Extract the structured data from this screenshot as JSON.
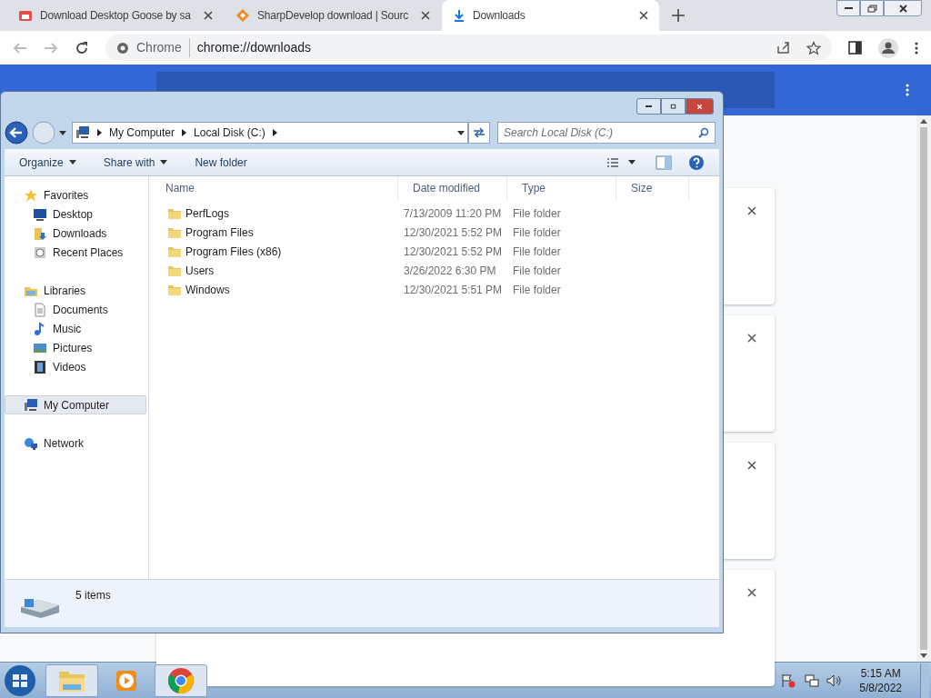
{
  "browser": {
    "tabs": [
      {
        "title": "Download Desktop Goose by sa",
        "kind": "goose",
        "selected": false
      },
      {
        "title": "SharpDevelop download | Sourc",
        "kind": "sharp",
        "selected": false
      },
      {
        "title": "Downloads",
        "kind": "download",
        "selected": true
      }
    ],
    "omnibox": {
      "site_label": "Chrome",
      "url": "chrome://downloads"
    },
    "download_cards": [
      {
        "kind": "item"
      },
      {
        "kind": "item"
      },
      {
        "kind": "item"
      },
      {
        "kind": "item"
      }
    ]
  },
  "explorer": {
    "breadcrumb": [
      "My Computer",
      "Local Disk (C:)"
    ],
    "search_placeholder": "Search Local Disk (C:)",
    "toolbar": [
      {
        "label": "Organize",
        "menu": true
      },
      {
        "label": "Share with",
        "menu": true
      },
      {
        "label": "New folder",
        "menu": false
      }
    ],
    "nav": [
      {
        "label": "Favorites",
        "kind": "star",
        "selected": false,
        "children": [
          {
            "label": "Desktop",
            "kind": "desktop",
            "selected": false
          },
          {
            "label": "Downloads",
            "kind": "downloads",
            "selected": false
          },
          {
            "label": "Recent Places",
            "kind": "recent",
            "selected": false
          }
        ]
      },
      {
        "label": "Libraries",
        "kind": "library",
        "selected": false,
        "children": [
          {
            "label": "Documents",
            "kind": "document",
            "selected": false
          },
          {
            "label": "Music",
            "kind": "music",
            "selected": false
          },
          {
            "label": "Pictures",
            "kind": "pictures",
            "selected": false
          },
          {
            "label": "Videos",
            "kind": "videos",
            "selected": false
          }
        ]
      },
      {
        "label": "My Computer",
        "kind": "computer",
        "selected": true
      },
      {
        "label": "Network",
        "kind": "network",
        "selected": false
      }
    ],
    "columns": [
      "Name",
      "Date modified",
      "Type",
      "Size"
    ],
    "rows": [
      {
        "name": "PerfLogs",
        "date": "7/13/2009 11:20 PM",
        "type": "File folder"
      },
      {
        "name": "Program Files",
        "date": "12/30/2021 5:52 PM",
        "type": "File folder"
      },
      {
        "name": "Program Files (x86)",
        "date": "12/30/2021 5:52 PM",
        "type": "File folder"
      },
      {
        "name": "Users",
        "date": "3/26/2022 6:30 PM",
        "type": "File folder"
      },
      {
        "name": "Windows",
        "date": "12/30/2021 5:51 PM",
        "type": "File folder"
      }
    ],
    "status": "5 items"
  },
  "taskbar": {
    "apps": [
      {
        "kind": "explorer",
        "selected": true
      },
      {
        "kind": "media",
        "selected": false
      },
      {
        "kind": "chrome",
        "selected": true
      }
    ],
    "time": "5:15 AM",
    "date": "5/8/2022"
  }
}
